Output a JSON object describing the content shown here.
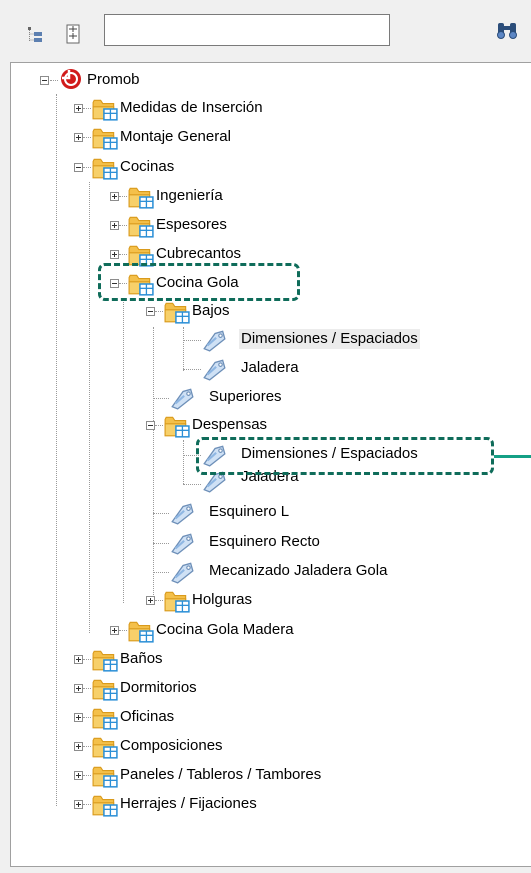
{
  "toolbar": {
    "search_value": "",
    "search_placeholder": "",
    "icons": [
      "tree-view-icon",
      "expand-all-icon",
      "binoculars-icon"
    ]
  },
  "colors": {
    "folder": "#f4c04a",
    "folder_dark": "#d99a1c",
    "badge": "#2b8fd6",
    "tag": "#8fb7e3",
    "root_red": "#d11a1a",
    "callout": "#0f6c5a",
    "arrow": "#14a085",
    "selected_bg": "#ececec"
  },
  "tree": {
    "root": "Promob",
    "items": [
      "Medidas de Inserción",
      "Montaje General",
      "Cocinas",
      "Ingeniería",
      "Espesores",
      "Cubrecantos",
      "Cocina Gola",
      "Bajos",
      "Dimensiones / Espaciados",
      "Jaladera",
      "Superiores",
      "Despensas",
      "Dimensiones / Espaciados",
      "Jaladera",
      "Esquinero L",
      "Esquinero Recto",
      "Mecanizado Jaladera Gola",
      "Holguras",
      "Cocina Gola Madera",
      "Baños",
      "Dormitorios",
      "Oficinas",
      "Composiciones",
      "Paneles / Tableros / Tambores",
      "Herrajes / Fijaciones"
    ]
  }
}
